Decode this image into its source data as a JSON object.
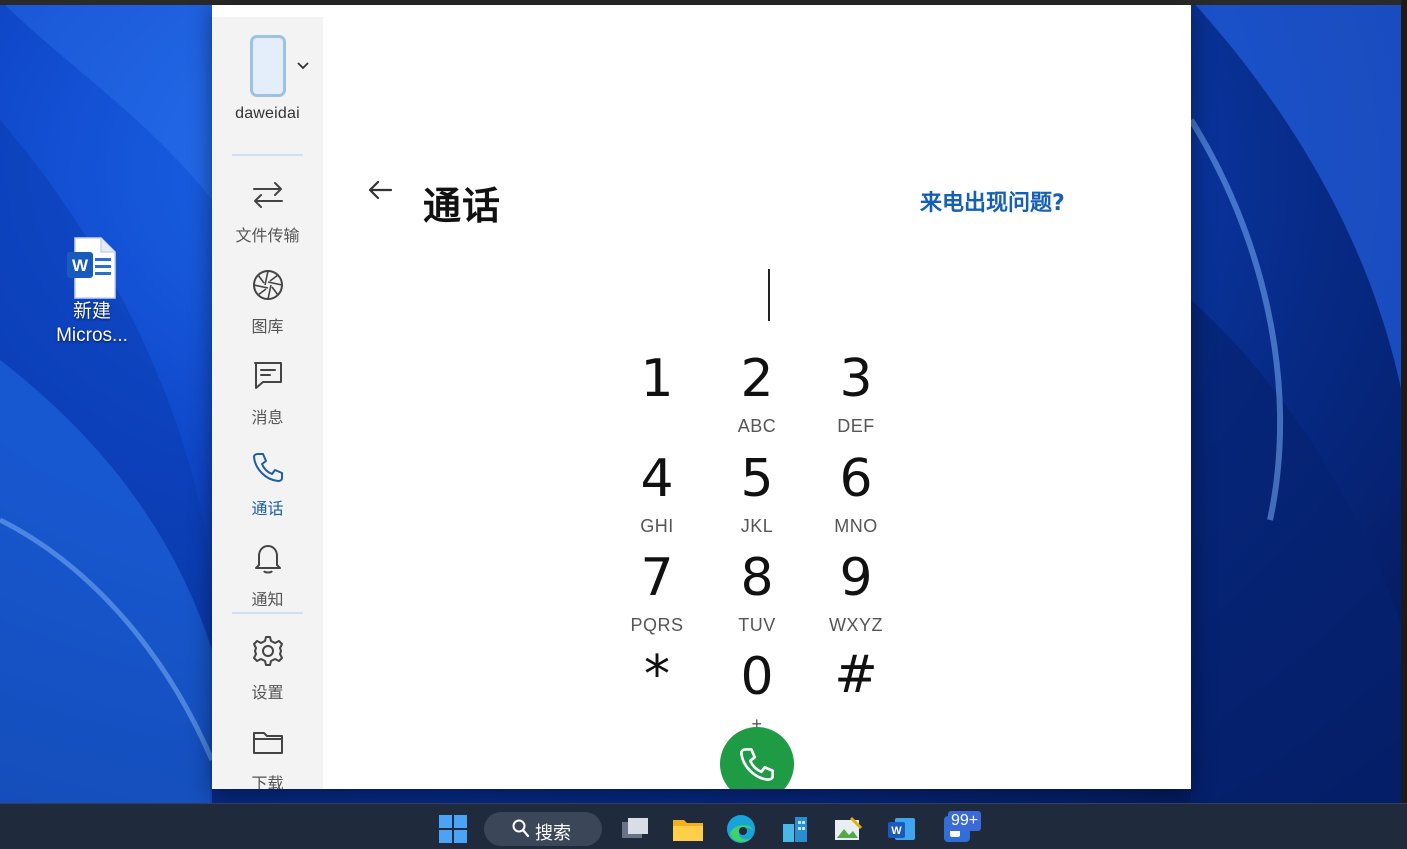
{
  "desktop": {
    "icon_label_line1": "新建",
    "icon_label_line2": "Micros..."
  },
  "sidebar": {
    "device_name": "daweidai",
    "items": [
      {
        "label": "文件传输",
        "icon": "transfer-icon"
      },
      {
        "label": "图库",
        "icon": "gallery-icon"
      },
      {
        "label": "消息",
        "icon": "message-icon"
      },
      {
        "label": "通话",
        "icon": "phone-icon",
        "active": true
      },
      {
        "label": "通知",
        "icon": "bell-icon"
      },
      {
        "label": "设置",
        "icon": "gear-icon"
      },
      {
        "label": "下载",
        "icon": "folder-icon"
      }
    ]
  },
  "calls": {
    "title": "通话",
    "help_link": "来电出现问题?",
    "number_value": ""
  },
  "keypad": [
    {
      "digit": "1",
      "letters": ""
    },
    {
      "digit": "2",
      "letters": "ABC"
    },
    {
      "digit": "3",
      "letters": "DEF"
    },
    {
      "digit": "4",
      "letters": "GHI"
    },
    {
      "digit": "5",
      "letters": "JKL"
    },
    {
      "digit": "6",
      "letters": "MNO"
    },
    {
      "digit": "7",
      "letters": "PQRS"
    },
    {
      "digit": "8",
      "letters": "TUV"
    },
    {
      "digit": "9",
      "letters": "WXYZ"
    },
    {
      "digit": "*",
      "letters": ""
    },
    {
      "digit": "0",
      "letters": "+"
    },
    {
      "digit": "#",
      "letters": ""
    }
  ],
  "taskbar": {
    "search_label": "搜索",
    "notification_badge": "99+"
  },
  "colors": {
    "accent": "#1660b4",
    "call_button": "#1f9b45"
  }
}
